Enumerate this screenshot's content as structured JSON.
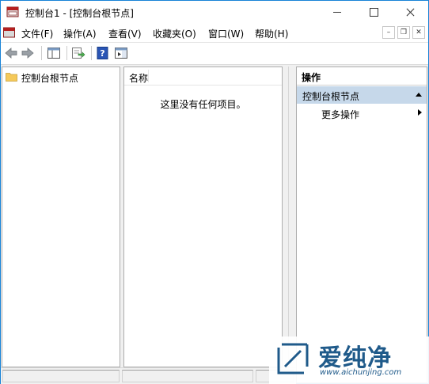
{
  "window": {
    "title": "控制台1 - [控制台根节点]"
  },
  "menubar": {
    "items": [
      "文件(F)",
      "操作(A)",
      "查看(V)",
      "收藏夹(O)",
      "窗口(W)",
      "帮助(H)"
    ],
    "mdi": {
      "minimize": "–",
      "restore": "❐",
      "close": "✕"
    }
  },
  "toolbar": {
    "icons": [
      "back-arrow-icon",
      "forward-arrow-icon",
      "show-tree-icon",
      "export-list-icon",
      "help-icon",
      "show-action-pane-icon"
    ]
  },
  "tree": {
    "root_label": "控制台根节点"
  },
  "list": {
    "column_name": "名称",
    "empty_message": "这里没有任何项目。"
  },
  "actions": {
    "header": "操作",
    "group_label": "控制台根节点",
    "more_actions": "更多操作"
  },
  "watermark": {
    "title": "爱纯净",
    "url": "www.aichunjing.com"
  },
  "colors": {
    "window_border": "#1883d7",
    "actions_group_bg": "#c6d8ea",
    "folder": "#f5c95a",
    "watermark": "#1f5a8a"
  }
}
